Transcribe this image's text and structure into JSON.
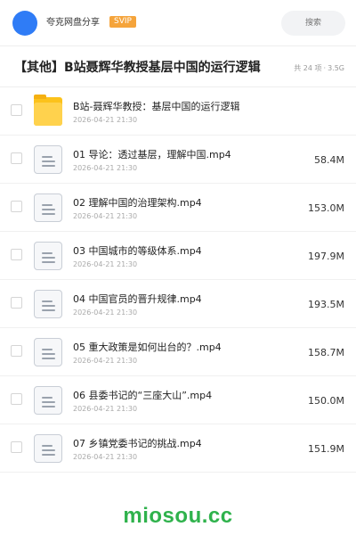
{
  "header": {
    "user_name": "夸克网盘分享",
    "badge": "SVIP",
    "search_placeholder": "搜索"
  },
  "share": {
    "title": "【其他】B站聂辉华教授基层中国的运行逻辑",
    "count": "共 24 项",
    "size": "3.5G"
  },
  "files": [
    {
      "name": "B站-聂辉华教授：基层中国的运行逻辑",
      "date": "2026-04-21 21:30",
      "size": "",
      "icon": "folder-icon"
    },
    {
      "name": "01 导论：透过基层，理解中国.mp4",
      "date": "2026-04-21 21:30",
      "size": "58.4M",
      "icon": "document-icon"
    },
    {
      "name": "02 理解中国的治理架构.mp4",
      "date": "2026-04-21 21:30",
      "size": "153.0M",
      "icon": "document-icon"
    },
    {
      "name": "03 中国城市的等级体系.mp4",
      "date": "2026-04-21 21:30",
      "size": "197.9M",
      "icon": "document-icon"
    },
    {
      "name": "04 中国官员的晋升规律.mp4",
      "date": "2026-04-21 21:30",
      "size": "193.5M",
      "icon": "document-icon"
    },
    {
      "name": "05 重大政策是如何出台的？.mp4",
      "date": "2026-04-21 21:30",
      "size": "158.7M",
      "icon": "document-icon"
    },
    {
      "name": "06 县委书记的“三座大山”.mp4",
      "date": "2026-04-21 21:30",
      "size": "150.0M",
      "icon": "document-icon"
    },
    {
      "name": "07 乡镇党委书记的挑战.mp4",
      "date": "2026-04-21 21:30",
      "size": "151.9M",
      "icon": "document-icon"
    }
  ],
  "watermark": "miosou.cc",
  "colors": {
    "accent_blue": "#2f7cf6",
    "svip_orange": "#f5a43b",
    "folder_yellow": "#fcc21b",
    "watermark_green": "#2fb24c"
  }
}
